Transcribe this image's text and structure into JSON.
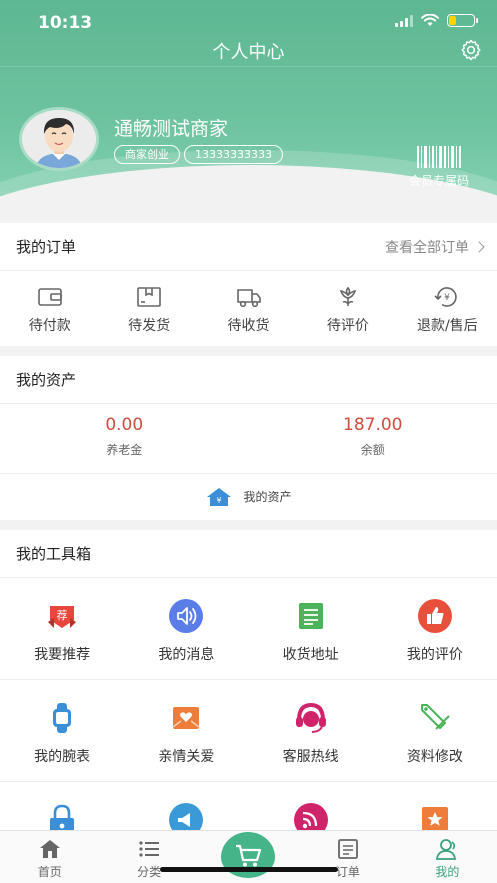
{
  "status_bar": {
    "time": "10:13"
  },
  "header": {
    "title": "个人中心",
    "user_name": "通畅测试商家",
    "tags": [
      "商家创业",
      "13333333333"
    ],
    "member_code_label": "会员专属码"
  },
  "orders": {
    "title": "我的订单",
    "view_all": "查看全部订单",
    "items": [
      {
        "label": "待付款",
        "icon": "wallet-icon"
      },
      {
        "label": "待发货",
        "icon": "package-icon"
      },
      {
        "label": "待收货",
        "icon": "truck-icon"
      },
      {
        "label": "待评价",
        "icon": "flower-icon"
      },
      {
        "label": "退款/售后",
        "icon": "refund-icon"
      }
    ]
  },
  "assets": {
    "title": "我的资产",
    "items": [
      {
        "value": "0.00",
        "label": "养老金"
      },
      {
        "value": "187.00",
        "label": "余额"
      }
    ],
    "footer_label": "我的资产"
  },
  "toolbox": {
    "title": "我的工具箱",
    "items": [
      {
        "label": "我要推荐",
        "icon": "recommend-badge-icon",
        "color": "#e8453c"
      },
      {
        "label": "我的消息",
        "icon": "speaker-icon",
        "color": "#5b7de8"
      },
      {
        "label": "收货地址",
        "icon": "address-note-icon",
        "color": "#4cb35b"
      },
      {
        "label": "我的评价",
        "icon": "thumbs-up-icon",
        "color": "#e8503c"
      },
      {
        "label": "我的腕表",
        "icon": "watch-icon",
        "color": "#3a8fd8"
      },
      {
        "label": "亲情关爱",
        "icon": "heart-mail-icon",
        "color": "#ee7c3a"
      },
      {
        "label": "客服热线",
        "icon": "headset-icon",
        "color": "#d0246a"
      },
      {
        "label": "资料修改",
        "icon": "tag-edit-icon",
        "color": "#4cb35b"
      },
      {
        "label": "",
        "icon": "lock-icon",
        "color": "#3a8fd8"
      },
      {
        "label": "",
        "icon": "megaphone-icon",
        "color": "#3a9ad8"
      },
      {
        "label": "",
        "icon": "rss-icon",
        "color": "#d0246a"
      },
      {
        "label": "",
        "icon": "star-icon",
        "color": "#ee7c3a"
      }
    ]
  },
  "tabbar": {
    "tabs": [
      {
        "label": "首页",
        "icon": "home-icon"
      },
      {
        "label": "分类",
        "icon": "list-icon"
      },
      {
        "label": "",
        "icon": "cart-icon"
      },
      {
        "label": "订单",
        "icon": "order-icon"
      },
      {
        "label": "我的",
        "icon": "user-icon"
      }
    ],
    "active_color": "#3aa27a"
  },
  "colors": {
    "brand": "#5db791",
    "price": "#d24a3c"
  }
}
